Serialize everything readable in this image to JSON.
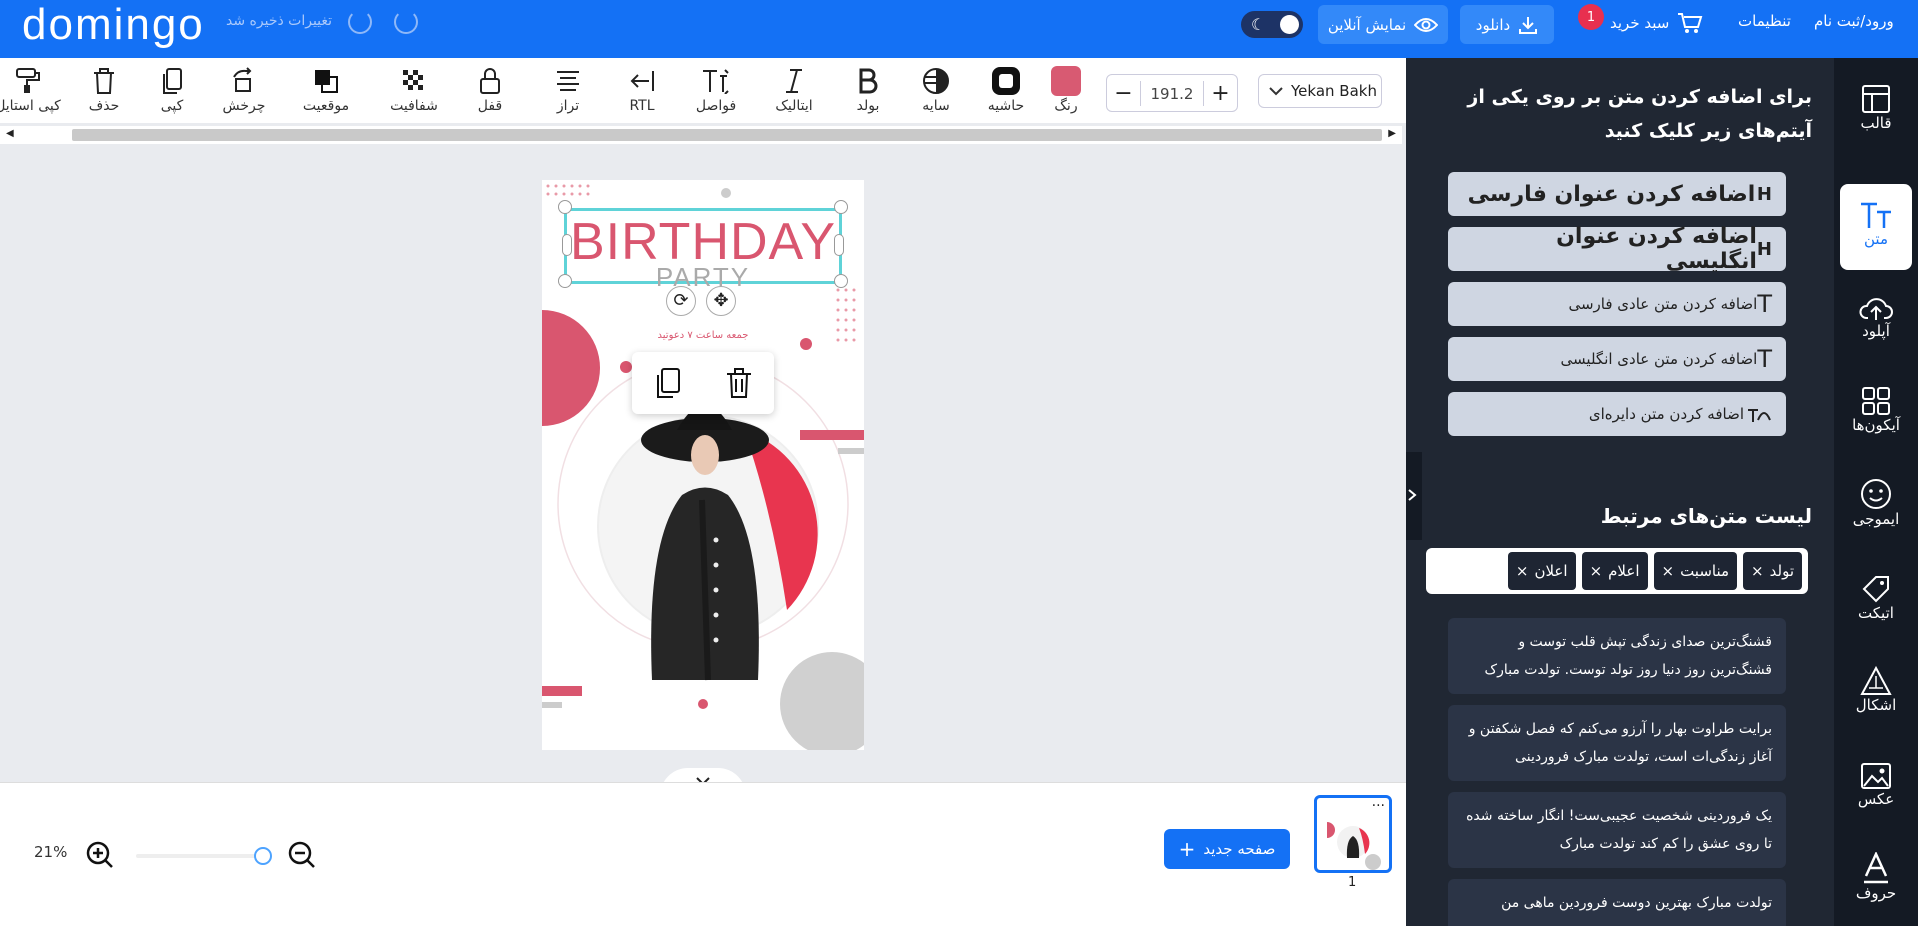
{
  "header": {
    "logo": "domingo",
    "save_status": "تغییرات ذخیره شد",
    "online_preview": "نمایش آنلاین",
    "download": "دانلود",
    "cart": "سبد خرید",
    "cart_count": "1",
    "settings": "تنظیمات",
    "login": "ورود/ثبت نام"
  },
  "toolbar": {
    "tools": [
      {
        "label": "کپی استایل",
        "icon": "paint-roller-icon"
      },
      {
        "label": "حذف",
        "icon": "trash-icon"
      },
      {
        "label": "کپی",
        "icon": "copy-icon"
      },
      {
        "label": "چرخش",
        "icon": "rotate-icon"
      },
      {
        "label": "موقعیت",
        "icon": "layers-icon"
      },
      {
        "label": "شفافیت",
        "icon": "transparency-icon"
      },
      {
        "label": "قفل",
        "icon": "lock-icon"
      },
      {
        "label": "تراز",
        "icon": "align-icon"
      },
      {
        "label": "RTL",
        "icon": "rtl-icon"
      },
      {
        "label": "فواصل",
        "icon": "spacing-icon"
      },
      {
        "label": "ایتالیک",
        "icon": "italic-icon"
      },
      {
        "label": "بولد",
        "icon": "bold-icon"
      },
      {
        "label": "سایه",
        "icon": "shadow-icon"
      },
      {
        "label": "حاشیه",
        "icon": "border-icon"
      },
      {
        "label": "رنگ",
        "icon": "color-swatch"
      }
    ],
    "font_size": "191.2",
    "font_family": "Yekan Bakh",
    "text_color": "#d85a72"
  },
  "canvas": {
    "title": "BIRTHDAY",
    "subtitle": "PARTY",
    "date_line": "جمعه ساعت ۷ دعوتید",
    "accent": "#d9566f"
  },
  "bottom": {
    "zoom": "21%",
    "new_page": "صفحه جدید",
    "page_number": "1"
  },
  "sidebar": {
    "heading": "برای اضافه کردن متن بر روی یکی از آیتم‌های زیر کلیک کنید",
    "add_buttons": [
      {
        "label": "اضافه کردن عنوان فارسی",
        "big": true
      },
      {
        "label": "اضافه کردن عنوان انگلیسی",
        "big": true
      },
      {
        "label": "اضافه کردن متن عادی فارسی",
        "big": false
      },
      {
        "label": "اضافه کردن متن عادی انگلیسی",
        "big": false
      },
      {
        "label": "اضافه کردن متن دایره‌ای",
        "big": false
      }
    ],
    "related_title": "لیست متن‌های مرتبط",
    "tags": [
      "تولد",
      "مناسبت",
      "اعلام",
      "اعلان"
    ],
    "suggestions": [
      "قشنگ‌ترین صدای زندگی تپش قلب توست و قشنگ‌ترین روز دنیا روز تولد توست. تولدت مبارک",
      "برایت طراوت بهار را آرزو می‌کنم که فصل شکفتن و آغاز زندگی‌ات است، تولدت مبارک فروردینی",
      "یک فروردینی شخصیت عجیبی‌ست! انگار ساخته شده تا روی عشق را کم کند تولدت مبارک",
      "تولدت مبارک بهترین دوست فروردین ماهی من"
    ]
  },
  "rail": [
    {
      "label": "قالب",
      "icon": "template-icon"
    },
    {
      "label": "متن",
      "icon": "text-icon"
    },
    {
      "label": "آپلود",
      "icon": "upload-icon"
    },
    {
      "label": "آیکون‌ها",
      "icon": "grid-icon"
    },
    {
      "label": "ایموجی",
      "icon": "emoji-icon"
    },
    {
      "label": "اتیکت",
      "icon": "tag-icon"
    },
    {
      "label": "اشکال",
      "icon": "shapes-icon"
    },
    {
      "label": "عکس",
      "icon": "image-icon"
    },
    {
      "label": "حروف",
      "icon": "letter-icon"
    }
  ]
}
